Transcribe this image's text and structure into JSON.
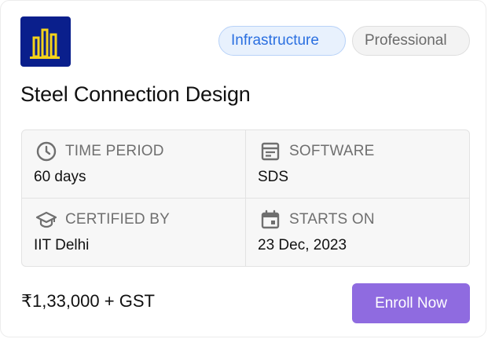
{
  "course": {
    "title": "Steel Connection Design",
    "logo_icon": "bar-chart-building-icon",
    "tags": [
      "Infrastructure",
      "Professional"
    ]
  },
  "details": {
    "time_period": {
      "label": "TIME PERIOD",
      "value": "60 days",
      "icon": "clock-icon"
    },
    "software": {
      "label": "SOFTWARE",
      "value": "SDS",
      "icon": "software-window-icon"
    },
    "certified_by": {
      "label": "CERTIFIED BY",
      "value": "IIT Delhi",
      "icon": "graduation-cap-icon"
    },
    "starts_on": {
      "label": "STARTS ON",
      "value": "23 Dec, 2023",
      "icon": "calendar-icon"
    }
  },
  "pricing": {
    "price": "₹1,33,000 + GST"
  },
  "actions": {
    "enroll_label": "Enroll Now"
  },
  "colors": {
    "logo_bg": "#0a1f8c",
    "logo_fg": "#f5d31a",
    "accent": "#8f6be0",
    "tag_blue": "#2a6fe0"
  }
}
